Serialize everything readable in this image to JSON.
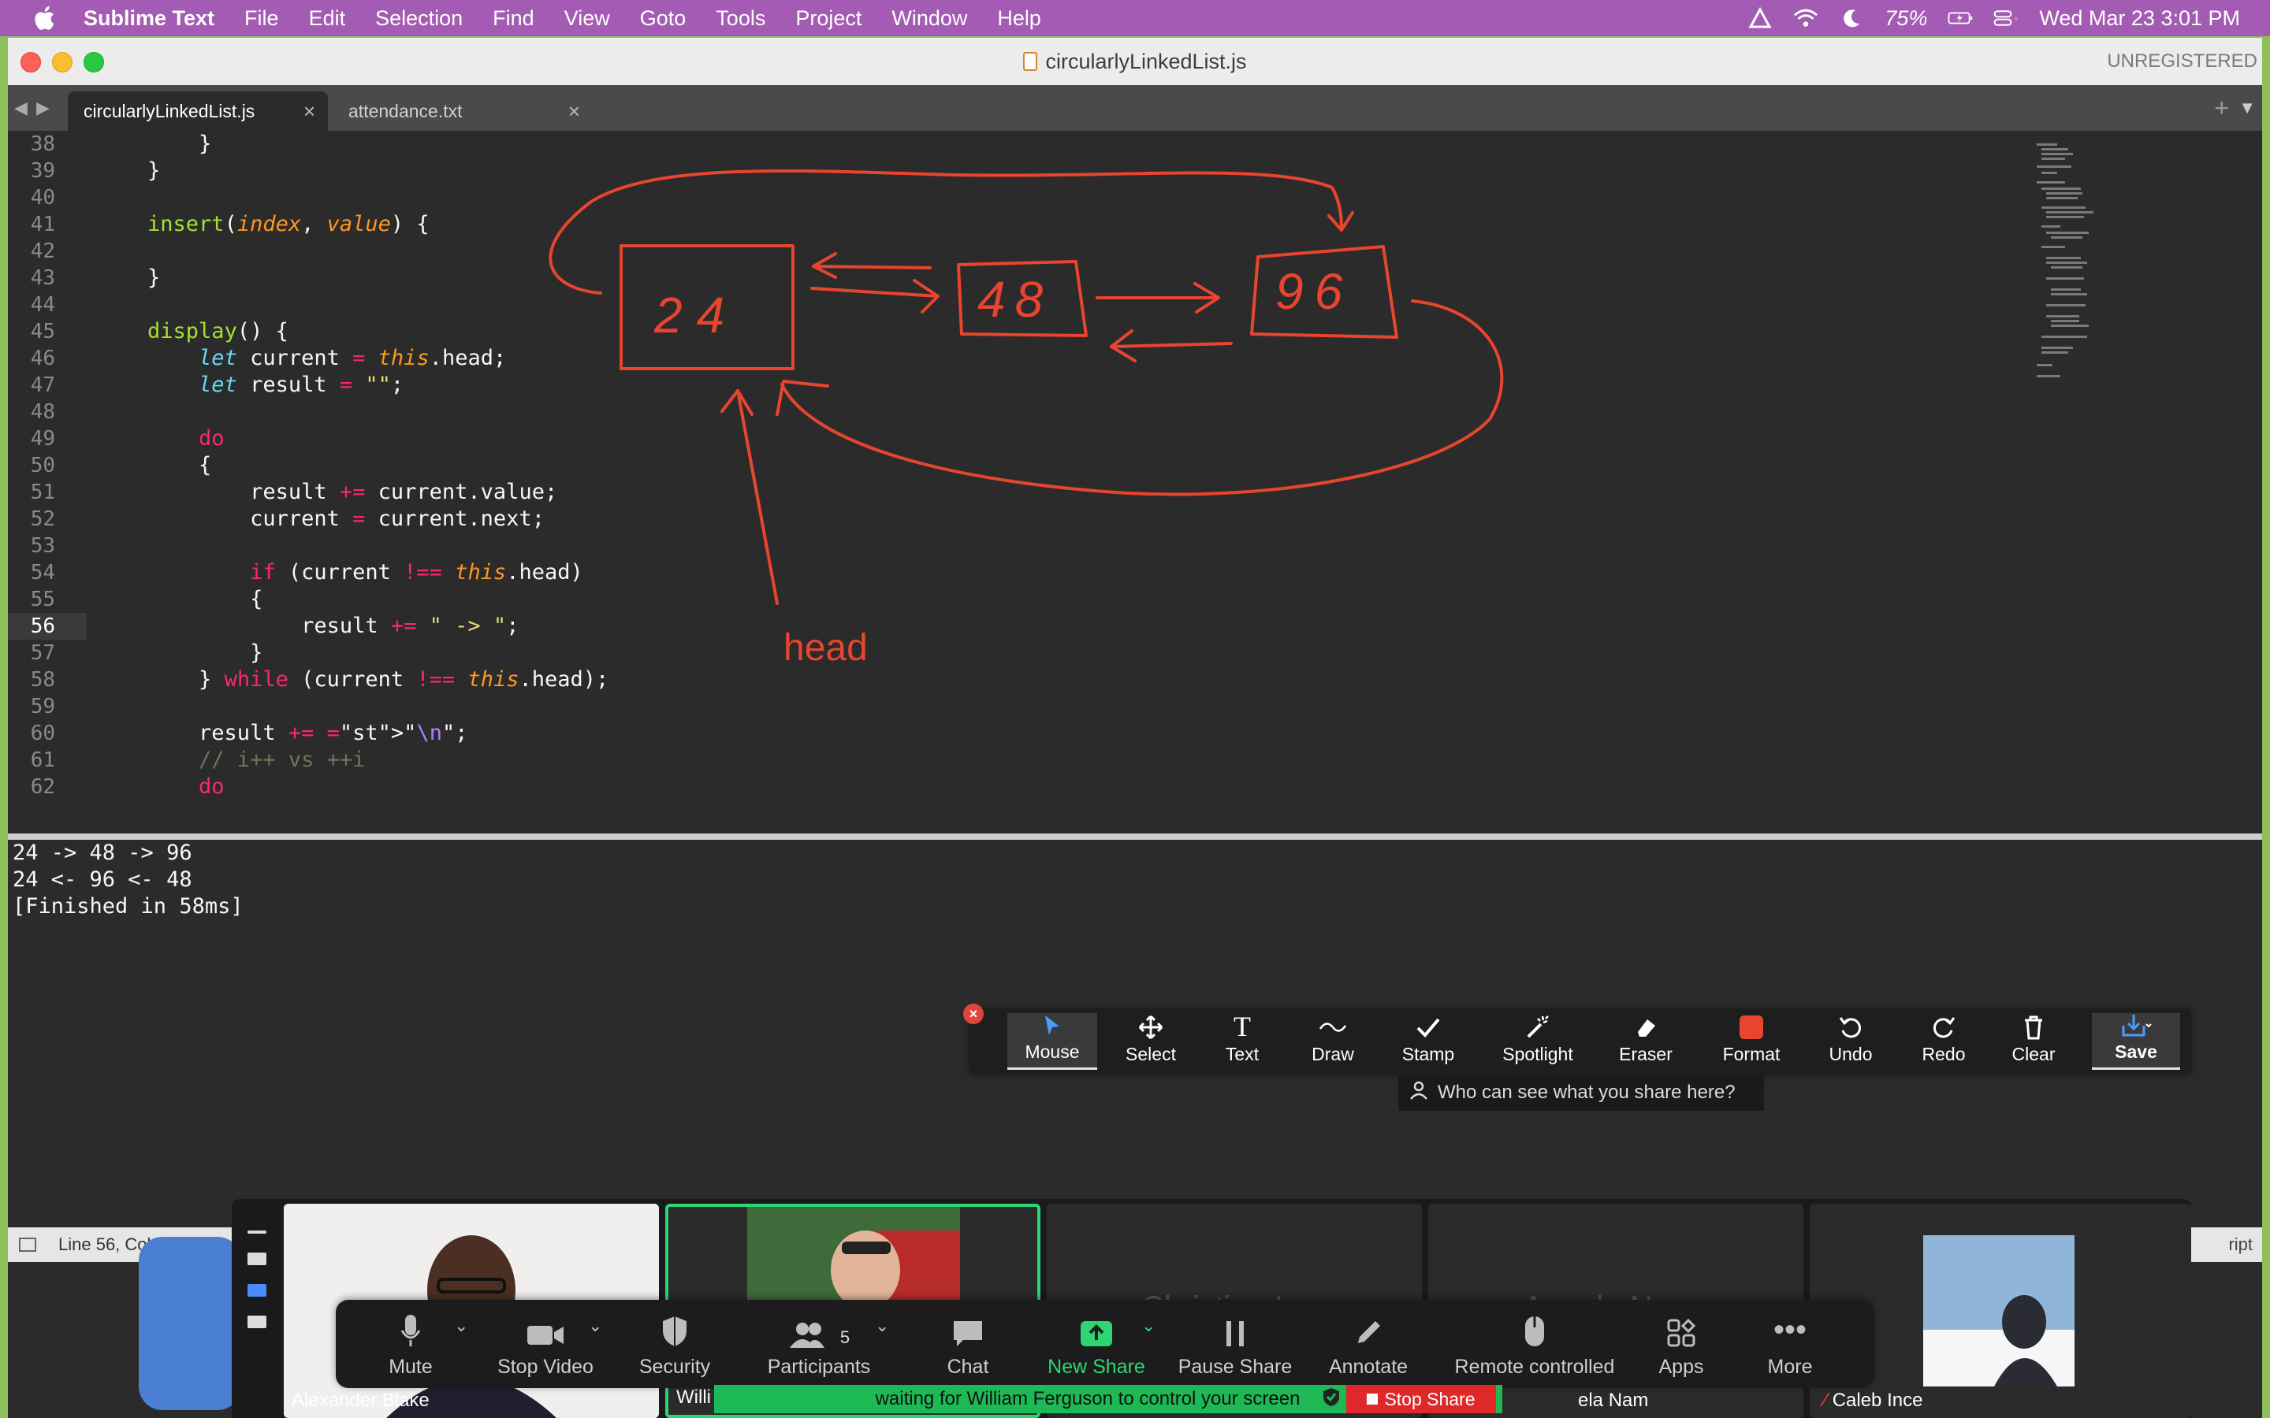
{
  "menubar": {
    "app_name": "Sublime Text",
    "items": [
      "File",
      "Edit",
      "Selection",
      "Find",
      "View",
      "Goto",
      "Tools",
      "Project",
      "Window",
      "Help"
    ],
    "battery": "75%",
    "datetime": "Wed Mar 23  3:01 PM"
  },
  "window": {
    "title": "circularlyLinkedList.js",
    "license": "UNREGISTERED",
    "tabs": [
      {
        "label": "circularlyLinkedList.js",
        "active": true
      },
      {
        "label": "attendance.txt",
        "active": false
      }
    ]
  },
  "editor": {
    "current_line": 56,
    "lines": [
      {
        "n": "38",
        "code": "        }"
      },
      {
        "n": "39",
        "code": "    }"
      },
      {
        "n": "40",
        "code": ""
      },
      {
        "n": "41",
        "code": "    insert(index, value) {"
      },
      {
        "n": "42",
        "code": ""
      },
      {
        "n": "43",
        "code": "    }"
      },
      {
        "n": "44",
        "code": ""
      },
      {
        "n": "45",
        "code": "    display() {"
      },
      {
        "n": "46",
        "code": "        let current = this.head;"
      },
      {
        "n": "47",
        "code": "        let result = \"\";"
      },
      {
        "n": "48",
        "code": ""
      },
      {
        "n": "49",
        "code": "        do"
      },
      {
        "n": "50",
        "code": "        {"
      },
      {
        "n": "51",
        "code": "            result += current.value;"
      },
      {
        "n": "52",
        "code": "            current = current.next;"
      },
      {
        "n": "53",
        "code": ""
      },
      {
        "n": "54",
        "code": "            if (current !== this.head)"
      },
      {
        "n": "55",
        "code": "            {"
      },
      {
        "n": "56",
        "code": "                result += \" -> \";"
      },
      {
        "n": "57",
        "code": "            }"
      },
      {
        "n": "58",
        "code": "        } while (current !== this.head);"
      },
      {
        "n": "59",
        "code": ""
      },
      {
        "n": "60",
        "code": "        result += \"\\n\";"
      },
      {
        "n": "61",
        "code": "        // i++ vs ++i"
      },
      {
        "n": "62",
        "code": "        do"
      }
    ]
  },
  "drawing": {
    "nodes": [
      "24",
      "48",
      "96"
    ],
    "label": "head",
    "color": "#e8452f"
  },
  "console": {
    "lines": [
      "24 -> 48 -> 96",
      "24 <- 96 <- 48",
      "[Finished in 58ms]"
    ]
  },
  "status": {
    "position": "Line 56, Column 29",
    "right": "ript"
  },
  "annotate_toolbar": {
    "tools": [
      "Mouse",
      "Select",
      "Text",
      "Draw",
      "Stamp",
      "Spotlight",
      "Eraser",
      "Format",
      "Undo",
      "Redo",
      "Clear",
      "Save"
    ],
    "selected": "Mouse",
    "hint": "Who can see what you share here?"
  },
  "zoom": {
    "participants_count": "5",
    "tiles": [
      {
        "name": "Alexander Blake"
      },
      {
        "name": "Willi"
      },
      {
        "name": "Christian L"
      },
      {
        "name": "Angela N"
      },
      {
        "name": "ela Nam"
      },
      {
        "name": "Caleb Ince"
      }
    ],
    "toolbar": [
      "Mute",
      "Stop Video",
      "Security",
      "Participants",
      "Chat",
      "New Share",
      "Pause Share",
      "Annotate",
      "Remote controlled",
      "Apps",
      "More"
    ],
    "banner": "waiting for William Ferguson to control your screen",
    "stop_share": "Stop Share"
  }
}
